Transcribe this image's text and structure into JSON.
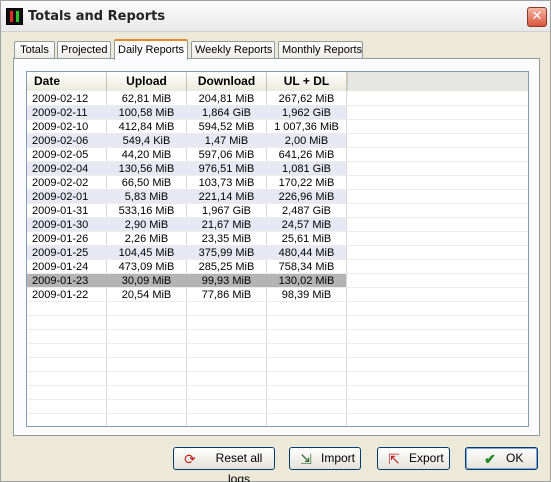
{
  "window": {
    "title": "Totals and Reports",
    "close_glyph": "✕"
  },
  "tabs": [
    {
      "label": "Totals"
    },
    {
      "label": "Projected"
    },
    {
      "label": "Daily Reports",
      "active": true
    },
    {
      "label": "Weekly Reports"
    },
    {
      "label": "Monthly Reports"
    }
  ],
  "table": {
    "columns": [
      "Date",
      "Upload",
      "Download",
      "UL + DL"
    ],
    "rows": [
      [
        "2009-02-12",
        "62,81 MiB",
        "204,81 MiB",
        "267,62 MiB"
      ],
      [
        "2009-02-11",
        "100,58 MiB",
        "1,864 GiB",
        "1,962 GiB"
      ],
      [
        "2009-02-10",
        "412,84 MiB",
        "594,52 MiB",
        "1 007,36 MiB"
      ],
      [
        "2009-02-06",
        "549,4 KiB",
        "1,47 MiB",
        "2,00 MiB"
      ],
      [
        "2009-02-05",
        "44,20 MiB",
        "597,06 MiB",
        "641,26 MiB"
      ],
      [
        "2009-02-04",
        "130,56 MiB",
        "976,51 MiB",
        "1,081 GiB"
      ],
      [
        "2009-02-02",
        "66,50 MiB",
        "103,73 MiB",
        "170,22 MiB"
      ],
      [
        "2009-02-01",
        "5,83 MiB",
        "221,14 MiB",
        "226,96 MiB"
      ],
      [
        "2009-01-31",
        "533,16 MiB",
        "1,967 GiB",
        "2,487 GiB"
      ],
      [
        "2009-01-30",
        "2,90 MiB",
        "21,67 MiB",
        "24,57 MiB"
      ],
      [
        "2009-01-26",
        "2,26 MiB",
        "23,35 MiB",
        "25,61 MiB"
      ],
      [
        "2009-01-25",
        "104,45 MiB",
        "375,99 MiB",
        "480,44 MiB"
      ],
      [
        "2009-01-24",
        "473,09 MiB",
        "285,25 MiB",
        "758,34 MiB"
      ],
      [
        "2009-01-23",
        "30,09 MiB",
        "99,93 MiB",
        "130,02 MiB"
      ],
      [
        "2009-01-22",
        "20,54 MiB",
        "77,86 MiB",
        "98,39 MiB"
      ]
    ],
    "selected_row": 13,
    "alt_color": "#e8e8f4",
    "selected_color": "#b4b4b4"
  },
  "buttons": {
    "reset": {
      "label": "Reset all logs",
      "icon": "refresh-icon"
    },
    "import": {
      "label": "Import",
      "icon": "import-icon"
    },
    "export": {
      "label": "Export",
      "icon": "export-icon"
    },
    "ok": {
      "label": "OK",
      "icon": "checkmark-icon"
    }
  }
}
